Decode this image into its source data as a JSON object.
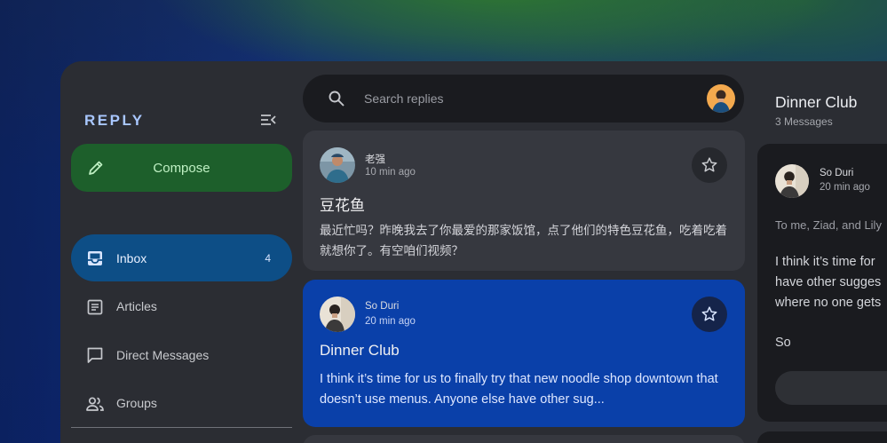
{
  "app": {
    "brand": "REPLY"
  },
  "sidebar": {
    "compose_label": "Compose",
    "items": [
      {
        "label": "Inbox",
        "count": "4",
        "icon": "inbox-icon",
        "active": true
      },
      {
        "label": "Articles",
        "count": "",
        "icon": "article-icon",
        "active": false
      },
      {
        "label": "Direct Messages",
        "count": "",
        "icon": "chat-bubble-icon",
        "active": false
      },
      {
        "label": "Groups",
        "count": "",
        "icon": "groups-icon",
        "active": false
      }
    ]
  },
  "search": {
    "placeholder": "Search replies"
  },
  "emails": [
    {
      "sender": "老强",
      "time": "10 min ago",
      "subject": "豆花鱼",
      "preview": "最近忙吗？昨晚我去了你最爱的那家饭馆，点了他们的特色豆花鱼，吃着吃着就想你了。有空咱们视频？",
      "selected": false
    },
    {
      "sender": "So Duri",
      "time": "20 min ago",
      "subject": "Dinner Club",
      "preview": "I think it’s time for us to finally try that new noodle shop downtown that doesn’t use menus. Anyone else have other sug...",
      "selected": true
    }
  ],
  "detail": {
    "title": "Dinner Club",
    "count": "3 Messages",
    "sender": "So Duri",
    "time": "20 min ago",
    "recipients": "To me, Ziad, and Lily",
    "body_lines": [
      "I think it’s time for",
      "have other sugges",
      "where no one gets"
    ],
    "signoff": "So"
  },
  "colors": {
    "accent_nav": "#0d4e86",
    "compose_bg": "#1d5f2b",
    "selected_card": "#0a40a9",
    "brand_text": "#a9c7ff"
  }
}
